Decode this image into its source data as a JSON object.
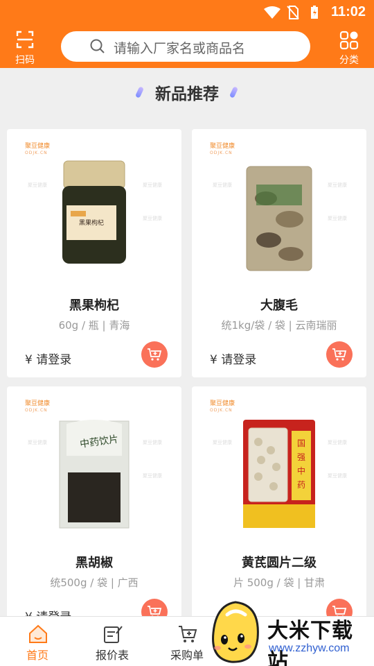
{
  "status_bar": {
    "time": "11:02"
  },
  "header": {
    "scan_label": "扫码",
    "search_placeholder": "请输入厂家名或商品名",
    "category_label": "分类"
  },
  "section": {
    "title": "新品推荐"
  },
  "brand_logo": {
    "cn": "聚豆健康",
    "en": "ODJK.CN"
  },
  "products": [
    {
      "name": "黑果枸杞",
      "spec": "60g / 瓶 | 青海",
      "price": "¥ 请登录"
    },
    {
      "name": "大腹毛",
      "spec": "统1kg/袋 / 袋 | 云南瑞丽",
      "price": "¥ 请登录"
    },
    {
      "name": "黑胡椒",
      "spec": "统500g / 袋 | 广西",
      "price": "¥ 请登录"
    },
    {
      "name": "黄芪圆片二级",
      "spec": "片 500g / 袋 | 甘肃",
      "price": ""
    }
  ],
  "tabbar": [
    {
      "label": "首页",
      "active": true
    },
    {
      "label": "报价表",
      "active": false
    },
    {
      "label": "采购单",
      "active": false
    }
  ],
  "promo": {
    "brand": "大米下载站",
    "url": "www.zzhyw.com"
  },
  "colors": {
    "primary": "#ff7a18",
    "cart": "#fa7159",
    "url": "#2f5fd0"
  },
  "icons": [
    "scan-icon",
    "search-icon",
    "category-icon",
    "cart-icon",
    "home-icon",
    "price-list-icon",
    "purchase-icon"
  ]
}
